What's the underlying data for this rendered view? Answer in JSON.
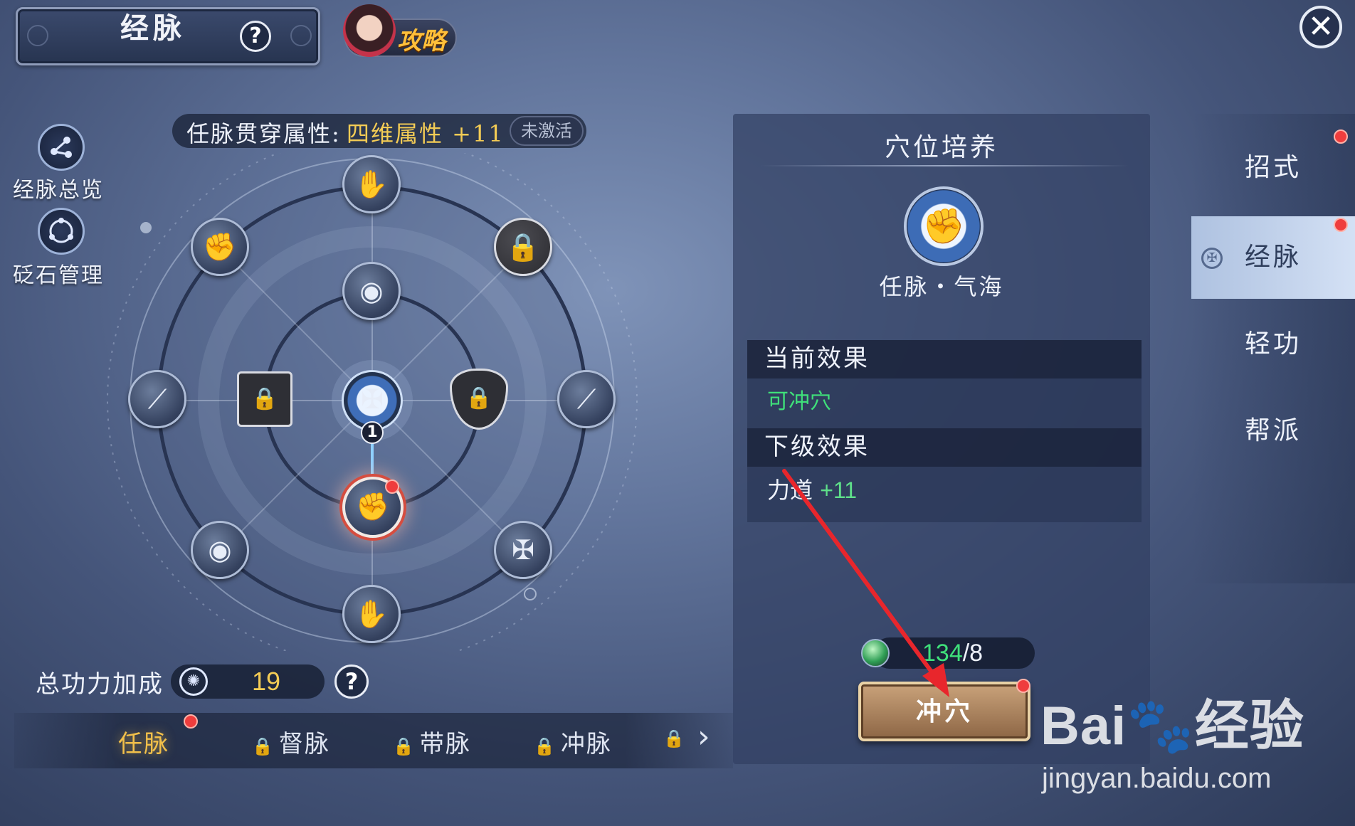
{
  "header": {
    "title": "经脉",
    "help_symbol": "?",
    "guide_label": "攻略",
    "close_symbol": "✕"
  },
  "left_tools": [
    {
      "label": "经脉总览",
      "icon": "network-icon"
    },
    {
      "label": "砭石管理",
      "icon": "ring-icon"
    }
  ],
  "attribute_banner": {
    "label": "任脉贯穿属性:",
    "value": "四维属性 +11",
    "status": "未激活"
  },
  "wheel": {
    "center_badge": "1",
    "lock_symbol": "🔒",
    "node_glyph": "✋",
    "eye_glyph": "◉",
    "stick_glyph": "⟋",
    "fist_glyph": "✊",
    "knot_glyph": "✠"
  },
  "power": {
    "label": "总功力加成",
    "value": "19",
    "help_symbol": "?"
  },
  "meridian_tabs": {
    "items": [
      {
        "label": "任脉",
        "locked": false,
        "active": true
      },
      {
        "label": "督脉",
        "locked": true
      },
      {
        "label": "带脉",
        "locked": true
      },
      {
        "label": "冲脉",
        "locked": true
      }
    ],
    "lock_symbol": "🔒",
    "next_symbol": "›"
  },
  "cultivate_panel": {
    "title": "穴位培养",
    "acupoint_glyph": "✊",
    "acupoint_name": "任脉・气海",
    "current_effect_title": "当前效果",
    "current_effect_value": "可冲穴",
    "next_effect_title": "下级效果",
    "next_effect_stat": "力道",
    "next_effect_bonus": "+11",
    "cost_have": "134",
    "cost_sep": "/8",
    "action_label": "冲穴"
  },
  "right_tabs": {
    "items": [
      "招式",
      "经脉",
      "轻功",
      "帮派"
    ],
    "active": "经脉"
  },
  "watermark": {
    "logo": "Bai🐾经验",
    "url": "jingyan.baidu.com"
  },
  "colors": {
    "accent_gold": "#f4cc55",
    "effect_green": "#3fe07a",
    "notify_red": "#ef3d3d"
  }
}
